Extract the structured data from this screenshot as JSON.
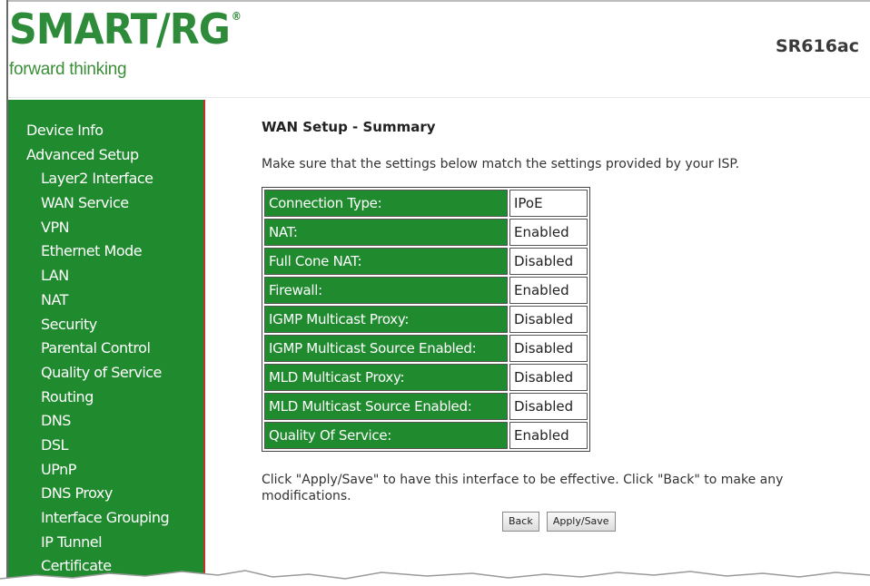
{
  "header": {
    "logo_text": "SMART/RG",
    "logo_reg": "®",
    "tagline": "forward thinking",
    "model": "SR616ac"
  },
  "sidebar": {
    "items": [
      {
        "label": "Device Info",
        "level": "top"
      },
      {
        "label": "Advanced Setup",
        "level": "top"
      },
      {
        "label": "Layer2 Interface",
        "level": "sub"
      },
      {
        "label": "WAN Service",
        "level": "sub"
      },
      {
        "label": "VPN",
        "level": "sub"
      },
      {
        "label": "Ethernet Mode",
        "level": "sub"
      },
      {
        "label": "LAN",
        "level": "sub"
      },
      {
        "label": "NAT",
        "level": "sub"
      },
      {
        "label": "Security",
        "level": "sub"
      },
      {
        "label": "Parental Control",
        "level": "sub"
      },
      {
        "label": "Quality of Service",
        "level": "sub"
      },
      {
        "label": "Routing",
        "level": "sub"
      },
      {
        "label": "DNS",
        "level": "sub"
      },
      {
        "label": "DSL",
        "level": "sub"
      },
      {
        "label": "UPnP",
        "level": "sub"
      },
      {
        "label": "DNS Proxy",
        "level": "sub"
      },
      {
        "label": "Interface Grouping",
        "level": "sub"
      },
      {
        "label": "IP Tunnel",
        "level": "sub"
      },
      {
        "label": "Certificate",
        "level": "sub"
      }
    ]
  },
  "main": {
    "title": "WAN Setup - Summary",
    "description": "Make sure that the settings below match the settings provided by your ISP.",
    "rows": [
      {
        "label": "Connection Type:",
        "value": "IPoE"
      },
      {
        "label": "NAT:",
        "value": "Enabled"
      },
      {
        "label": "Full Cone NAT:",
        "value": "Disabled"
      },
      {
        "label": "Firewall:",
        "value": "Enabled"
      },
      {
        "label": "IGMP Multicast Proxy:",
        "value": "Disabled"
      },
      {
        "label": "IGMP Multicast Source Enabled:",
        "value": "Disabled"
      },
      {
        "label": "MLD Multicast Proxy:",
        "value": "Disabled"
      },
      {
        "label": "MLD Multicast Source Enabled:",
        "value": "Disabled"
      },
      {
        "label": "Quality Of Service:",
        "value": "Enabled"
      }
    ],
    "note": "Click \"Apply/Save\" to have this interface to be effective. Click \"Back\" to make any modifications.",
    "back_label": "Back",
    "apply_label": "Apply/Save"
  },
  "colors": {
    "brand_green": "#2e8b3a",
    "sidebar_green": "#1f8a2e",
    "sidebar_border": "#c4312b"
  }
}
